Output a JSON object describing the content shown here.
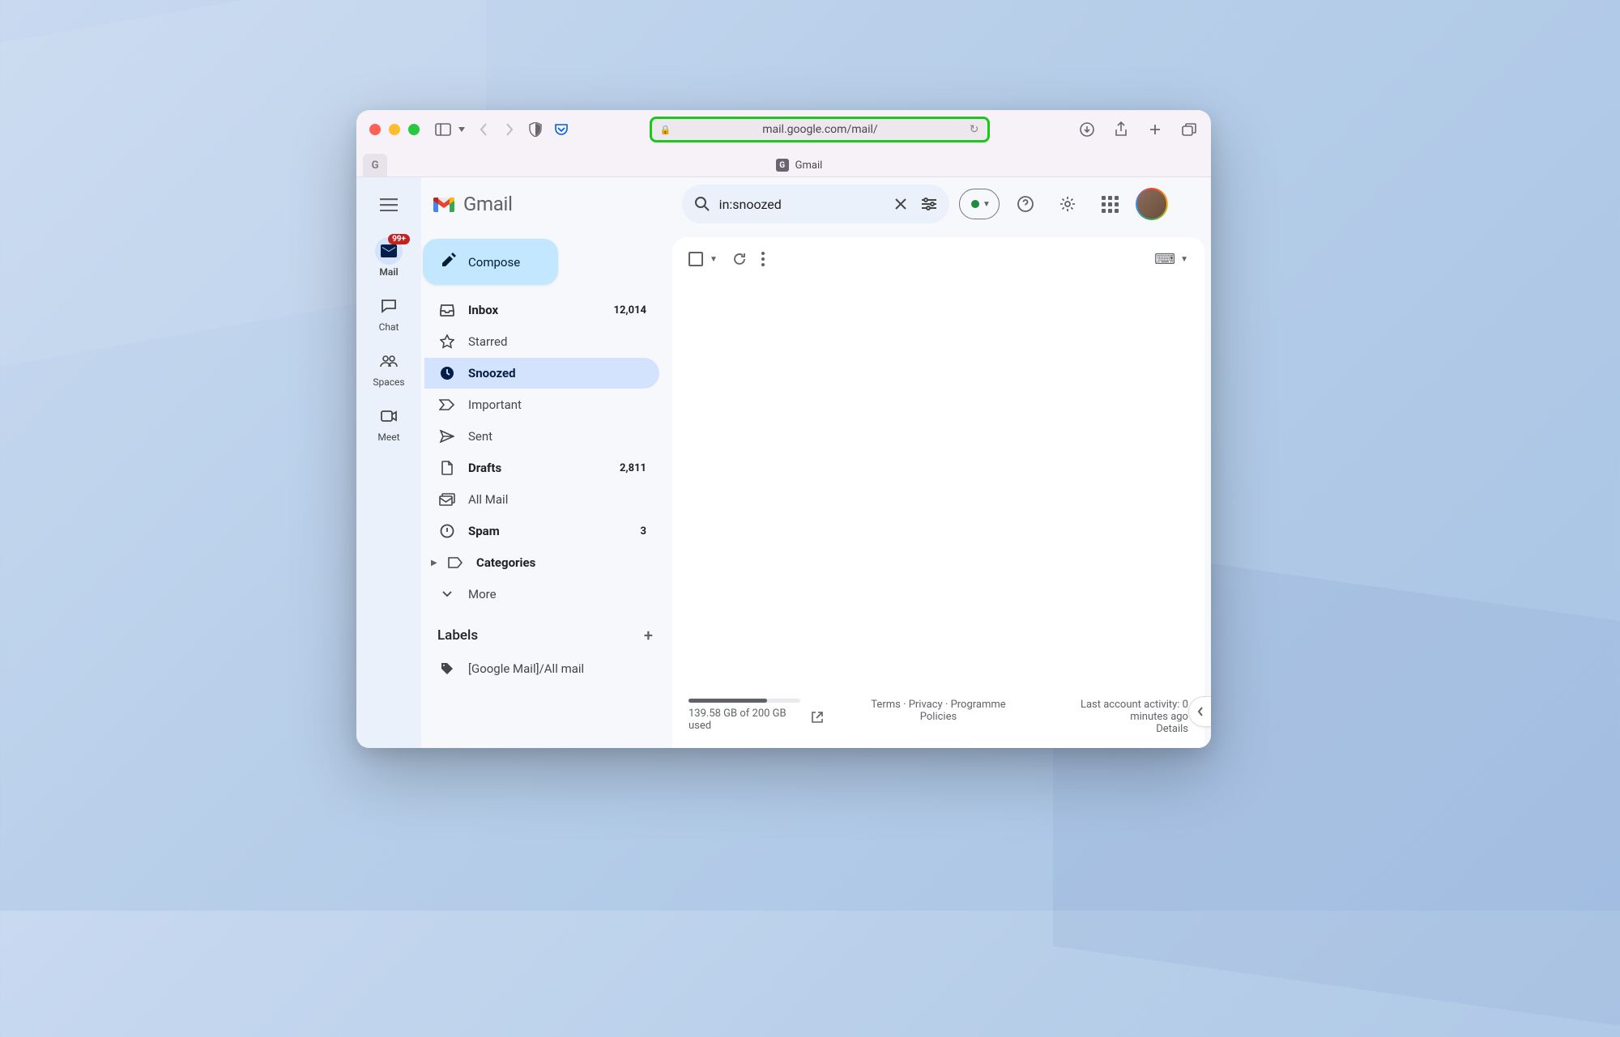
{
  "browser": {
    "url": "mail.google.com/mail/",
    "tab_title": "Gmail",
    "pinned_tab_letter": "G"
  },
  "header": {
    "brand": "Gmail",
    "search_value": "in:snoozed"
  },
  "rail": {
    "badge": "99+",
    "items": [
      {
        "label": "Mail"
      },
      {
        "label": "Chat"
      },
      {
        "label": "Spaces"
      },
      {
        "label": "Meet"
      }
    ]
  },
  "compose_label": "Compose",
  "nav": [
    {
      "key": "inbox",
      "label": "Inbox",
      "count": "12,014",
      "bold": true
    },
    {
      "key": "starred",
      "label": "Starred",
      "count": ""
    },
    {
      "key": "snoozed",
      "label": "Snoozed",
      "count": "",
      "active": true,
      "bold": true
    },
    {
      "key": "important",
      "label": "Important",
      "count": ""
    },
    {
      "key": "sent",
      "label": "Sent",
      "count": ""
    },
    {
      "key": "drafts",
      "label": "Drafts",
      "count": "2,811",
      "bold": true
    },
    {
      "key": "allmail",
      "label": "All Mail",
      "count": ""
    },
    {
      "key": "spam",
      "label": "Spam",
      "count": "3",
      "bold": true
    },
    {
      "key": "categories",
      "label": "Categories",
      "count": "",
      "bold": true,
      "expandable": true
    },
    {
      "key": "more",
      "label": "More",
      "count": ""
    }
  ],
  "labels": {
    "heading": "Labels",
    "items": [
      {
        "label": "[Google Mail]/All mail"
      }
    ]
  },
  "footer": {
    "storage_used": "139.58 GB",
    "storage_total": "200 GB",
    "storage_text": "139.58 GB of 200 GB used",
    "storage_pct": 70,
    "links": {
      "terms": "Terms",
      "privacy": "Privacy",
      "policies": "Programme Policies"
    },
    "activity_line1": "Last account activity: 0",
    "activity_line2": "minutes ago",
    "details": "Details"
  }
}
